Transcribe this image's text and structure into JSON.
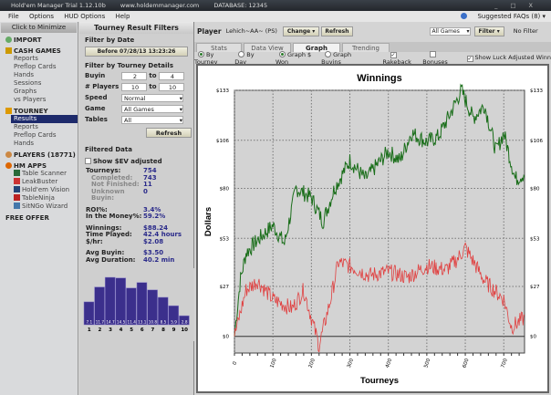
{
  "window": {
    "title": "Hold'em Manager Trial 1.12.10b",
    "url": "www.holdemmanager.com",
    "database": "DATABASE: 12345",
    "controls": [
      "_",
      "□",
      "X"
    ]
  },
  "menu": [
    "File",
    "Options",
    "HUD Options",
    "Help"
  ],
  "faq": "Suggested FAQs (8) ▾",
  "nav": {
    "minimize": "Click to Minimize",
    "import": "IMPORT",
    "cash_games": "CASH GAMES",
    "cash_items": [
      "Reports",
      "Preflop Cards",
      "Hands",
      "Sessions",
      "Graphs",
      "vs Players"
    ],
    "tourney": "TOURNEY",
    "tourney_items": [
      "Results",
      "Reports",
      "Preflop Cards",
      "Hands"
    ],
    "players": "PLAYERS (18771)",
    "hm_apps": "HM APPS",
    "apps": [
      "Table Scanner",
      "LeakBuster",
      "Hold'em Vision",
      "TableNinja",
      "SitNGo Wizard"
    ],
    "free_offer": "FREE OFFER"
  },
  "filters": {
    "title": "Tourney Result Filters",
    "by_date": "Filter by Date",
    "date_btn": "Before 07/28/13 13:23:26",
    "by_details": "Filter by Tourney Details",
    "buyin_label": "Buyin",
    "buyin_from": "2",
    "buyin_to": "4",
    "to": "to",
    "players_label": "# Players",
    "players_from": "10",
    "players_to": "10",
    "speed_label": "Speed",
    "speed": "Normal",
    "game_label": "Game",
    "game": "All Games",
    "tables_label": "Tables",
    "tables": "All",
    "refresh": "Refresh",
    "filtered": "Filtered Data",
    "sev": "Show $EV adjusted",
    "stats": [
      {
        "k": "Tourneys:",
        "v": "754"
      },
      {
        "k": "Completed:",
        "v": "743",
        "sub": true
      },
      {
        "k": "Not Finished:",
        "v": "11",
        "sub": true
      },
      {
        "k": "Unknown Buyin:",
        "v": "0",
        "sub": true
      },
      {
        "gap": true
      },
      {
        "k": "ROI%:",
        "v": "3.4%"
      },
      {
        "k": "In the Money%:",
        "v": "59.2%"
      },
      {
        "gap": true
      },
      {
        "k": "Winnings:",
        "v": "$88.24"
      },
      {
        "k": "Time Played:",
        "v": "42.4 hours"
      },
      {
        "k": "$/hr:",
        "v": "$2.08"
      },
      {
        "gap": true
      },
      {
        "k": "Avg Buyin:",
        "v": "$3.50"
      },
      {
        "k": "Avg Duration:",
        "v": "40.2 min"
      }
    ]
  },
  "finish_hist": {
    "places": [
      "1",
      "2",
      "3",
      "4",
      "5",
      "6",
      "7",
      "8",
      "9",
      "10"
    ],
    "values": [
      7.1,
      11.7,
      14.7,
      14.5,
      11.4,
      13.1,
      10.8,
      8.5,
      5.9,
      2.8
    ]
  },
  "player": {
    "label": "Player",
    "name": "Lehich~AA~ (PS)",
    "change": "Change",
    "refresh": "Refresh",
    "games": "All Games",
    "filter": "Filter",
    "no_filter": "No Filter"
  },
  "tabs": [
    "Stats",
    "Data View",
    "Graph",
    "Trending"
  ],
  "options": {
    "by_tourney": "By Tourney",
    "by_day": "By Day",
    "won": "Graph $ Won",
    "buyins": "Graph Buyins",
    "rakeback": "Rakeback",
    "bonuses": "Bonuses",
    "luck": "Show Luck Adjusted Winn"
  },
  "chart_data": {
    "type": "line",
    "title": "Winnings",
    "xlabel": "Tourneys",
    "ylabel": "Dollars",
    "xlim": [
      0,
      754
    ],
    "ylim": [
      -9,
      133
    ],
    "yticks": [
      "$0",
      "$27",
      "$53",
      "$80",
      "$106",
      "$133"
    ],
    "ytick_values": [
      0,
      27,
      53,
      80,
      106,
      133
    ],
    "xticks": [
      "0",
      "100",
      "200",
      "300",
      "400",
      "500",
      "600",
      "700"
    ],
    "series": [
      {
        "name": "Winnings",
        "color": "#1a6e1a",
        "x": [
          0,
          15,
          30,
          60,
          100,
          130,
          160,
          200,
          230,
          260,
          300,
          340,
          400,
          430,
          460,
          500,
          530,
          560,
          590,
          620,
          650,
          680,
          700,
          730,
          754
        ],
        "y": [
          0,
          30,
          45,
          52,
          60,
          50,
          80,
          75,
          62,
          80,
          95,
          85,
          100,
          95,
          110,
          105,
          108,
          120,
          133,
          118,
          125,
          100,
          110,
          85,
          88
        ]
      },
      {
        "name": "Luck Adjusted",
        "color": "#e04040",
        "x": [
          0,
          30,
          60,
          100,
          150,
          180,
          200,
          220,
          250,
          270,
          300,
          350,
          400,
          450,
          500,
          550,
          580,
          600,
          650,
          700,
          720,
          754
        ],
        "y": [
          0,
          25,
          30,
          20,
          15,
          25,
          10,
          -5,
          20,
          40,
          38,
          33,
          35,
          32,
          38,
          36,
          42,
          48,
          30,
          20,
          5,
          10
        ]
      }
    ]
  }
}
